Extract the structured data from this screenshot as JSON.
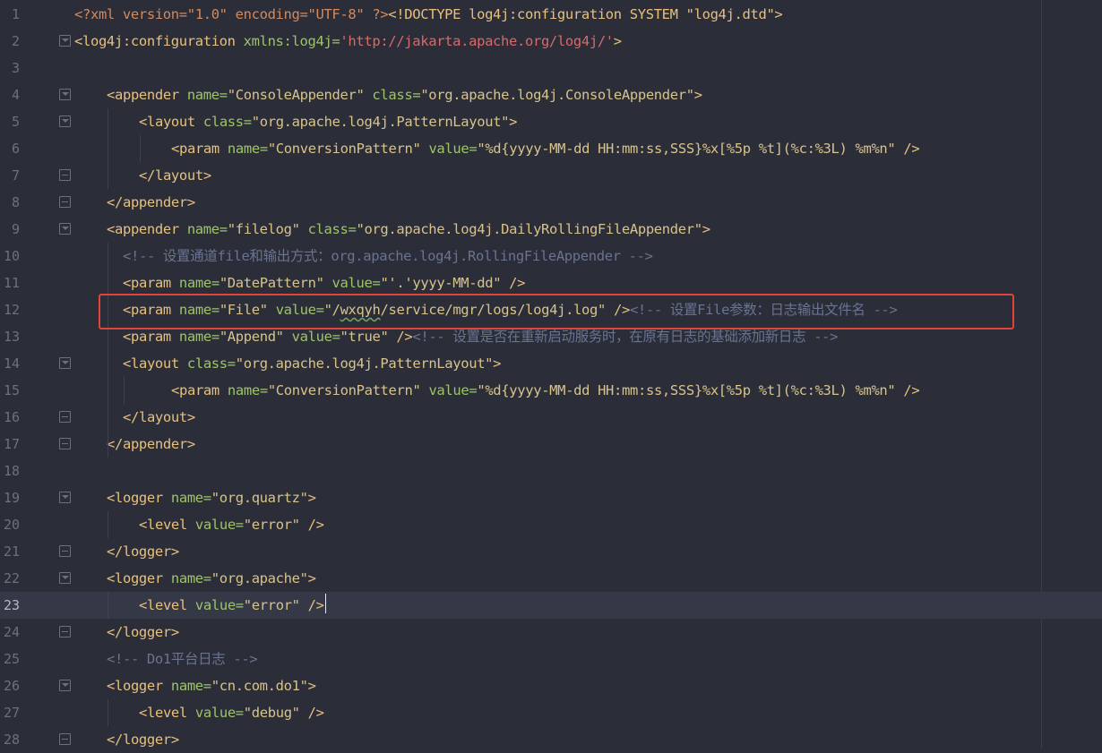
{
  "editor": {
    "current_line": 23,
    "lines": [
      {
        "n": "1",
        "indent": 0,
        "fold": "none",
        "segs": [
          [
            "pi",
            "<?xml version=\"1.0\" encoding=\"UTF-8\" ?>"
          ],
          [
            "tag",
            "<!DOCTYPE log4j:configuration SYSTEM \"log4j.dtd\">"
          ]
        ]
      },
      {
        "n": "2",
        "indent": 0,
        "fold": "open",
        "segs": [
          [
            "tag",
            "<log4j:configuration"
          ],
          [
            "attr",
            " xmlns:log4j="
          ],
          [
            "url",
            "'http://jakarta.apache.org/log4j/'"
          ],
          [
            "tag",
            ">"
          ]
        ]
      },
      {
        "n": "3",
        "indent": 0,
        "fold": "none",
        "segs": []
      },
      {
        "n": "4",
        "indent": 1,
        "fold": "open",
        "segs": [
          [
            "tag",
            "<appender"
          ],
          [
            "attr",
            " name="
          ],
          [
            "str",
            "\"ConsoleAppender\""
          ],
          [
            "attr",
            " class="
          ],
          [
            "str",
            "\"org.apache.log4j.ConsoleAppender\""
          ],
          [
            "tag",
            ">"
          ]
        ]
      },
      {
        "n": "5",
        "indent": 2,
        "fold": "open",
        "segs": [
          [
            "tag",
            "<layout"
          ],
          [
            "attr",
            " class="
          ],
          [
            "str",
            "\"org.apache.log4j.PatternLayout\""
          ],
          [
            "tag",
            ">"
          ]
        ]
      },
      {
        "n": "6",
        "indent": 3,
        "fold": "none",
        "segs": [
          [
            "tag",
            "<param"
          ],
          [
            "attr",
            " name="
          ],
          [
            "str",
            "\"ConversionPattern\""
          ],
          [
            "attr",
            " value="
          ],
          [
            "str",
            "\"%d{yyyy-MM-dd HH:mm:ss,SSS}%x[%5p %t](%c:%3L) %m%n\""
          ],
          [
            "tag",
            " />"
          ]
        ]
      },
      {
        "n": "7",
        "indent": 2,
        "fold": "close",
        "segs": [
          [
            "tag",
            "</layout>"
          ]
        ]
      },
      {
        "n": "8",
        "indent": 1,
        "fold": "close",
        "segs": [
          [
            "tag",
            "</appender>"
          ]
        ]
      },
      {
        "n": "9",
        "indent": 1,
        "fold": "open",
        "segs": [
          [
            "tag",
            "<appender"
          ],
          [
            "attr",
            " name="
          ],
          [
            "str",
            "\"filelog\""
          ],
          [
            "attr",
            " class="
          ],
          [
            "str",
            "\"org.apache.log4j.DailyRollingFileAppender\""
          ],
          [
            "tag",
            ">"
          ]
        ]
      },
      {
        "n": "10",
        "indent": 1.5,
        "fold": "none",
        "segs": [
          [
            "com",
            "<!-- 设置通道file和输出方式：org.apache.log4j.RollingFileAppender -->"
          ]
        ]
      },
      {
        "n": "11",
        "indent": 1.5,
        "fold": "none",
        "segs": [
          [
            "tag",
            "<param"
          ],
          [
            "attr",
            " name="
          ],
          [
            "str",
            "\"DatePattern\""
          ],
          [
            "attr",
            " value="
          ],
          [
            "str",
            "\"'.'yyyy-MM-dd\""
          ],
          [
            "tag",
            " />"
          ]
        ]
      },
      {
        "n": "12",
        "indent": 1.5,
        "fold": "none",
        "segs": [
          [
            "tag",
            "<param"
          ],
          [
            "attr",
            " name="
          ],
          [
            "str",
            "\"File\""
          ],
          [
            "attr",
            " value="
          ],
          [
            "str",
            "\"/"
          ],
          [
            "sq",
            "wxqyh"
          ],
          [
            "str",
            "/service/mgr/logs/log4j.log\""
          ],
          [
            "tag",
            " />"
          ],
          [
            "com",
            "<!-- 设置File参数：日志输出文件名 -->"
          ]
        ]
      },
      {
        "n": "13",
        "indent": 1.5,
        "fold": "none",
        "segs": [
          [
            "tag",
            "<param"
          ],
          [
            "attr",
            " name="
          ],
          [
            "str",
            "\"Append\""
          ],
          [
            "attr",
            " value="
          ],
          [
            "str",
            "\"true\""
          ],
          [
            "tag",
            " />"
          ],
          [
            "com",
            "<!-- 设置是否在重新启动服务时，在原有日志的基础添加新日志 -->"
          ]
        ]
      },
      {
        "n": "14",
        "indent": 1.5,
        "fold": "open",
        "segs": [
          [
            "tag",
            "<layout"
          ],
          [
            "attr",
            " class="
          ],
          [
            "str",
            "\"org.apache.log4j.PatternLayout\""
          ],
          [
            "tag",
            ">"
          ]
        ]
      },
      {
        "n": "15",
        "indent": 3,
        "fold": "none",
        "segs": [
          [
            "tag",
            "<param"
          ],
          [
            "attr",
            " name="
          ],
          [
            "str",
            "\"ConversionPattern\""
          ],
          [
            "attr",
            " value="
          ],
          [
            "str",
            "\"%d{yyyy-MM-dd HH:mm:ss,SSS}%x[%5p %t](%c:%3L) %m%n\""
          ],
          [
            "tag",
            " />"
          ]
        ]
      },
      {
        "n": "16",
        "indent": 1.5,
        "fold": "close",
        "segs": [
          [
            "tag",
            "</layout>"
          ]
        ]
      },
      {
        "n": "17",
        "indent": 1,
        "fold": "close",
        "segs": [
          [
            "tag",
            "</appender>"
          ]
        ]
      },
      {
        "n": "18",
        "indent": 0,
        "fold": "none",
        "segs": []
      },
      {
        "n": "19",
        "indent": 1,
        "fold": "open",
        "segs": [
          [
            "tag",
            "<logger"
          ],
          [
            "attr",
            " name="
          ],
          [
            "str",
            "\"org.quartz\""
          ],
          [
            "tag",
            ">"
          ]
        ]
      },
      {
        "n": "20",
        "indent": 2,
        "fold": "none",
        "segs": [
          [
            "tag",
            "<level"
          ],
          [
            "attr",
            " value="
          ],
          [
            "str",
            "\"error\""
          ],
          [
            "tag",
            " />"
          ]
        ]
      },
      {
        "n": "21",
        "indent": 1,
        "fold": "close",
        "segs": [
          [
            "tag",
            "</logger>"
          ]
        ]
      },
      {
        "n": "22",
        "indent": 1,
        "fold": "open",
        "segs": [
          [
            "tag",
            "<logger"
          ],
          [
            "attr",
            " name="
          ],
          [
            "str",
            "\"org.apache\""
          ],
          [
            "tag",
            ">"
          ]
        ]
      },
      {
        "n": "23",
        "indent": 2,
        "fold": "none",
        "segs": [
          [
            "tag",
            "<level"
          ],
          [
            "attr",
            " value="
          ],
          [
            "str",
            "\"error\""
          ],
          [
            "tag",
            " />"
          ]
        ]
      },
      {
        "n": "24",
        "indent": 1,
        "fold": "close",
        "segs": [
          [
            "tag",
            "</logger>"
          ]
        ]
      },
      {
        "n": "25",
        "indent": 1,
        "fold": "none",
        "segs": [
          [
            "com",
            "<!-- Do1平台日志 -->"
          ]
        ]
      },
      {
        "n": "26",
        "indent": 1,
        "fold": "open",
        "segs": [
          [
            "tag",
            "<logger"
          ],
          [
            "attr",
            " name="
          ],
          [
            "str",
            "\"cn.com.do1\""
          ],
          [
            "tag",
            ">"
          ]
        ]
      },
      {
        "n": "27",
        "indent": 2,
        "fold": "none",
        "segs": [
          [
            "tag",
            "<level"
          ],
          [
            "attr",
            " value="
          ],
          [
            "str",
            "\"debug\""
          ],
          [
            "tag",
            " />"
          ]
        ]
      },
      {
        "n": "28",
        "indent": 1,
        "fold": "close",
        "segs": [
          [
            "tag",
            "</logger>"
          ]
        ]
      }
    ]
  },
  "colors": {
    "background": "#2b2d38",
    "tag": "#e8c07d",
    "attribute": "#9ec46a",
    "string": "#d8c38a",
    "comment": "#6a7491",
    "url": "#d86a6a",
    "highlight_box": "#e0433a"
  }
}
